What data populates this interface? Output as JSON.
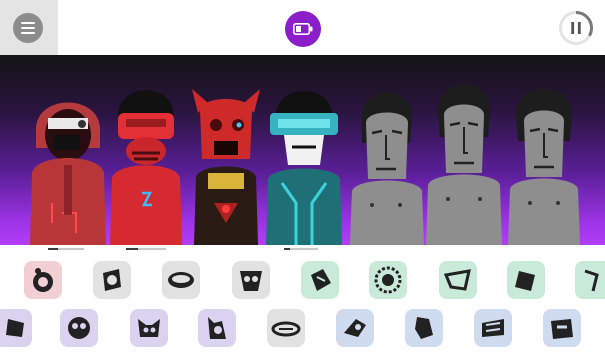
{
  "top_bar": {
    "menu_icon": "hamburger-menu-icon",
    "battery_icon": "battery-low-icon",
    "pause_icon": "pause-icon",
    "accent_color": "#8a1ec9"
  },
  "stage": {
    "background_colors": [
      "#141414",
      "#5a1f98",
      "#b23ef5"
    ],
    "characters": [
      {
        "slot": 1,
        "status": "active",
        "color": "#c23a3a"
      },
      {
        "slot": 2,
        "status": "active",
        "color": "#d8282f"
      },
      {
        "slot": 3,
        "status": "active",
        "color": "#cf2a2a"
      },
      {
        "slot": 4,
        "status": "active",
        "color": "#2fa3a7"
      },
      {
        "slot": 5,
        "status": "empty",
        "color": "#8e8e8e"
      },
      {
        "slot": 6,
        "status": "empty",
        "color": "#8e8e8e"
      },
      {
        "slot": 7,
        "status": "empty",
        "color": "#8e8e8e"
      }
    ]
  },
  "sound_icons": {
    "row1": [
      {
        "name": "beat-sound-1",
        "color": "#f2cfd2"
      },
      {
        "name": "beat-sound-2",
        "color": "#e2e2e2"
      },
      {
        "name": "beat-sound-3",
        "color": "#e2e2e2"
      },
      {
        "name": "beat-sound-4",
        "color": "#e2e2e2"
      },
      {
        "name": "effect-sound-1",
        "color": "#c9ead8"
      },
      {
        "name": "effect-sound-2",
        "color": "#c9ead8"
      },
      {
        "name": "effect-sound-3",
        "color": "#c9ead8"
      },
      {
        "name": "effect-sound-4",
        "color": "#c9ead8"
      },
      {
        "name": "effect-sound-5",
        "color": "#c9ead8"
      }
    ],
    "row2": [
      {
        "name": "melody-sound-1",
        "color": "#d9d3ef"
      },
      {
        "name": "melody-sound-2",
        "color": "#d9d3ef"
      },
      {
        "name": "melody-sound-3",
        "color": "#d9d3ef"
      },
      {
        "name": "melody-sound-4",
        "color": "#d9d3ef"
      },
      {
        "name": "melody-sound-5",
        "color": "#e2e2e2"
      },
      {
        "name": "voice-sound-1",
        "color": "#cfdbef"
      },
      {
        "name": "voice-sound-2",
        "color": "#cfdbef"
      },
      {
        "name": "voice-sound-3",
        "color": "#cfdbef"
      },
      {
        "name": "voice-sound-4",
        "color": "#cfdbef"
      }
    ]
  }
}
